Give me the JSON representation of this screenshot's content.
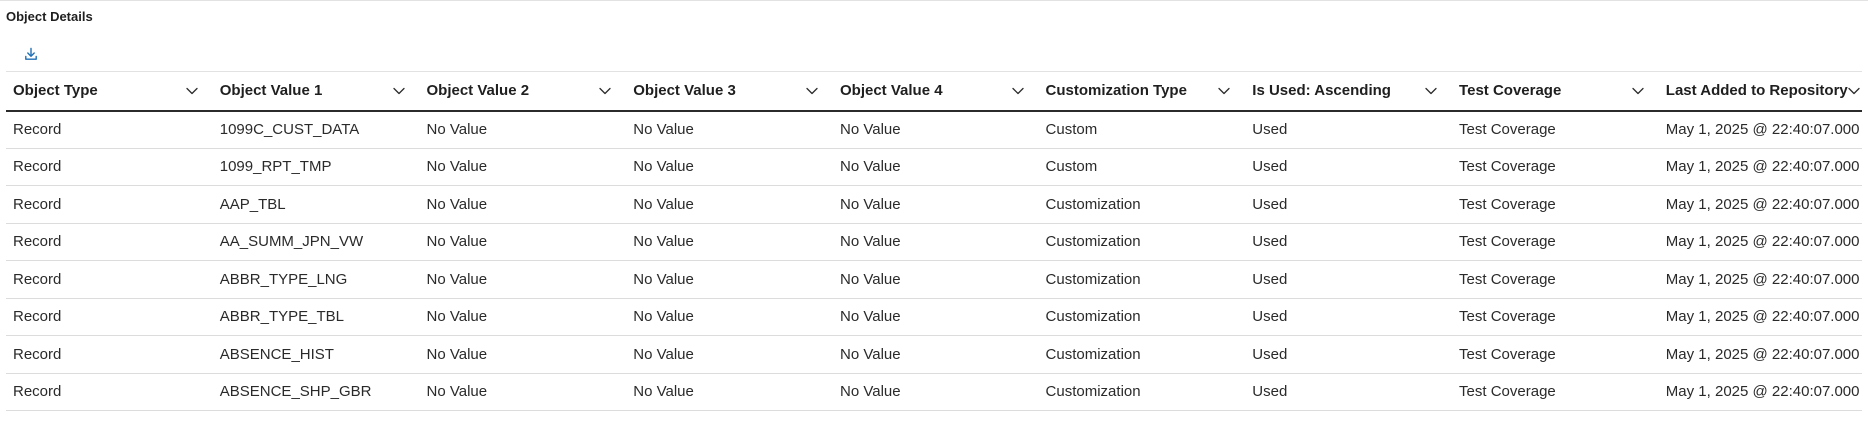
{
  "panel": {
    "title": "Object Details"
  },
  "toolbar": {
    "download_icon": "download-icon"
  },
  "colors": {
    "accent": "#1f6fb5",
    "header_rule": "#2b2b2b",
    "row_rule": "#dcdcdc"
  },
  "table": {
    "columns": [
      "Object Type",
      "Object Value 1",
      "Object Value 2",
      "Object Value 3",
      "Object Value 4",
      "Customization Type",
      "Is Used: Ascending",
      "Test Coverage",
      "Last Added to Repository"
    ],
    "rows": [
      [
        "Record",
        "1099C_CUST_DATA",
        "No Value",
        "No Value",
        "No Value",
        "Custom",
        "Used",
        "Test Coverage",
        "May 1, 2025 @ 22:40:07.000"
      ],
      [
        "Record",
        "1099_RPT_TMP",
        "No Value",
        "No Value",
        "No Value",
        "Custom",
        "Used",
        "Test Coverage",
        "May 1, 2025 @ 22:40:07.000"
      ],
      [
        "Record",
        "AAP_TBL",
        "No Value",
        "No Value",
        "No Value",
        "Customization",
        "Used",
        "Test Coverage",
        "May 1, 2025 @ 22:40:07.000"
      ],
      [
        "Record",
        "AA_SUMM_JPN_VW",
        "No Value",
        "No Value",
        "No Value",
        "Customization",
        "Used",
        "Test Coverage",
        "May 1, 2025 @ 22:40:07.000"
      ],
      [
        "Record",
        "ABBR_TYPE_LNG",
        "No Value",
        "No Value",
        "No Value",
        "Customization",
        "Used",
        "Test Coverage",
        "May 1, 2025 @ 22:40:07.000"
      ],
      [
        "Record",
        "ABBR_TYPE_TBL",
        "No Value",
        "No Value",
        "No Value",
        "Customization",
        "Used",
        "Test Coverage",
        "May 1, 2025 @ 22:40:07.000"
      ],
      [
        "Record",
        "ABSENCE_HIST",
        "No Value",
        "No Value",
        "No Value",
        "Customization",
        "Used",
        "Test Coverage",
        "May 1, 2025 @ 22:40:07.000"
      ],
      [
        "Record",
        "ABSENCE_SHP_GBR",
        "No Value",
        "No Value",
        "No Value",
        "Customization",
        "Used",
        "Test Coverage",
        "May 1, 2025 @ 22:40:07.000"
      ]
    ]
  }
}
